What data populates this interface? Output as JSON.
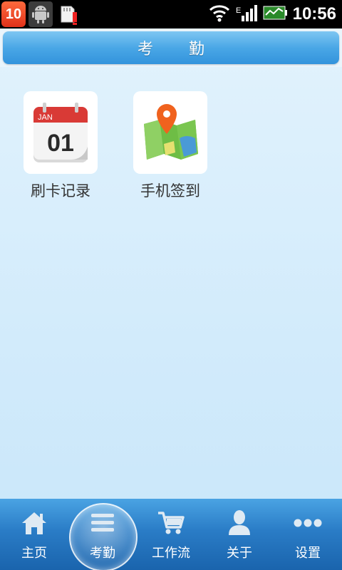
{
  "status_bar": {
    "notification_count": "10",
    "time": "10:56"
  },
  "header": {
    "title": "考　勤"
  },
  "tiles": [
    {
      "label": "刷卡记录",
      "icon": "calendar-icon",
      "calendar_month": "JAN",
      "calendar_day": "01"
    },
    {
      "label": "手机签到",
      "icon": "map-pin-icon"
    }
  ],
  "bottom_nav": {
    "items": [
      {
        "label": "主页",
        "icon": "home-icon"
      },
      {
        "label": "考勤",
        "icon": "menu-icon",
        "active": true
      },
      {
        "label": "工作流",
        "icon": "cart-icon"
      },
      {
        "label": "关于",
        "icon": "person-icon"
      },
      {
        "label": "设置",
        "icon": "more-dots-icon"
      }
    ]
  },
  "colors": {
    "title_bar": "#4aa7e6",
    "bottom_nav": "#2a7cc6",
    "background": "#d2ebfb"
  }
}
